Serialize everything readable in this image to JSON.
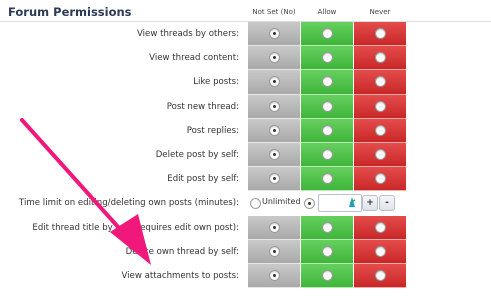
{
  "header": {
    "title": "Forum Permissions",
    "columns": [
      "Not Set (No)",
      "Allow",
      "Never"
    ]
  },
  "rows": [
    {
      "label": "View threads by others:",
      "type": "tri"
    },
    {
      "label": "View thread content:",
      "type": "tri"
    },
    {
      "label": "Like posts:",
      "type": "tri"
    },
    {
      "label": "Post new thread:",
      "type": "tri"
    },
    {
      "label": "Post replies:",
      "type": "tri"
    },
    {
      "label": "Delete post by self:",
      "type": "tri"
    },
    {
      "label": "Edit post by self:",
      "type": "tri"
    },
    {
      "label": "Time limit on editing/deleting own posts (minutes):",
      "type": "time",
      "unlimited_label": "Unlimited",
      "plus": "+",
      "minus": "-"
    },
    {
      "label": "Edit thread title by self (requires edit own post):",
      "type": "tri"
    },
    {
      "label": "Delete own thread by self:",
      "type": "tri"
    },
    {
      "label": "View attachments to posts:",
      "type": "tri"
    }
  ],
  "colors": {
    "not_set": "#b9b9b9",
    "allow": "#4cc447",
    "never": "#d93535",
    "annotation_arrow": "#f0187a"
  },
  "annotation": {
    "shape": "arrow",
    "points_to": "View attachments to posts"
  }
}
